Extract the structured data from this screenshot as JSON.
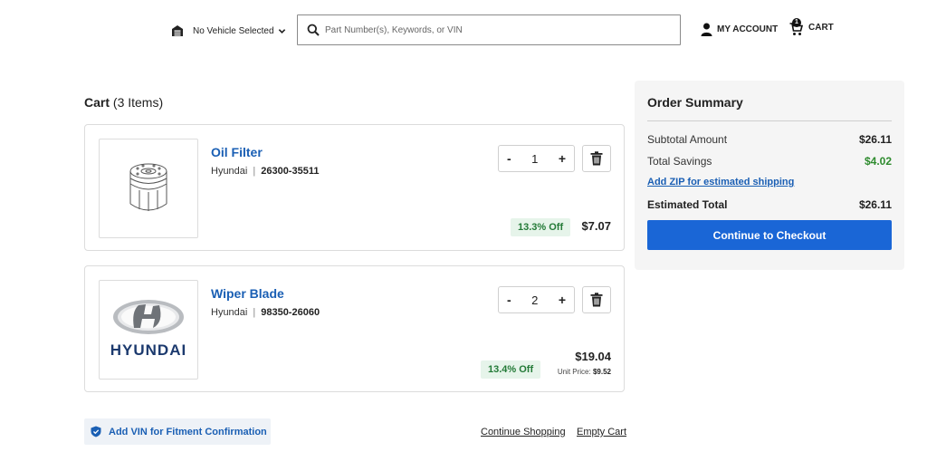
{
  "header": {
    "vehicle_label": "No Vehicle Selected",
    "search_placeholder": "Part Number(s), Keywords, or VIN",
    "account_label": "MY ACCOUNT",
    "cart_label": "CART",
    "cart_count": "1"
  },
  "cart": {
    "title": "Cart",
    "items_count": "(3 Items)",
    "items": [
      {
        "name": "Oil Filter",
        "brand": "Hyundai",
        "part_number": "26300-35511",
        "quantity": "1",
        "discount": "13.3% Off",
        "price": "$7.07",
        "thumb_icon": "oil-filter-icon"
      },
      {
        "name": "Wiper Blade",
        "brand": "Hyundai",
        "part_number": "98350-26060",
        "quantity": "2",
        "discount": "13.4% Off",
        "price": "$19.04",
        "unit_price_label": "Unit Price:",
        "unit_price": "$9.52",
        "thumb_icon": "hyundai-logo",
        "logo_text": "HYUNDAI"
      }
    ],
    "minus": "-",
    "plus": "+"
  },
  "footer": {
    "vin_label": "Add VIN for Fitment Confirmation",
    "continue_shopping": "Continue Shopping",
    "empty_cart": "Empty Cart"
  },
  "summary": {
    "title": "Order Summary",
    "subtotal_label": "Subtotal Amount",
    "subtotal_value": "$26.11",
    "savings_label": "Total Savings",
    "savings_value": "$4.02",
    "zip_link": "Add ZIP for estimated shipping",
    "total_label": "Estimated Total",
    "total_value": "$26.11",
    "checkout_label": "Continue to Checkout"
  },
  "colors": {
    "link_blue": "#1a5fb4",
    "button_blue": "#1a66d6",
    "discount_green": "#237a37",
    "savings_green": "#2e8b2e"
  }
}
